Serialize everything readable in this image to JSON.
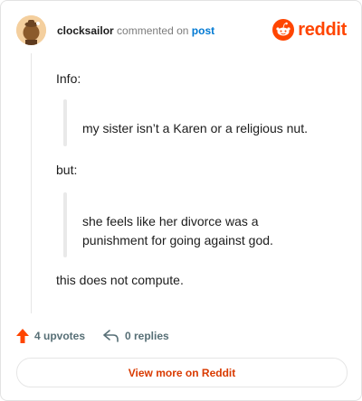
{
  "header": {
    "username": "clocksailor",
    "action_text": "commented on",
    "post_link": "post",
    "brand": "reddit",
    "brand_color": "#ff4500"
  },
  "comment": {
    "paragraph_1": "Info:",
    "quote_1": "my sister isn’t a Karen or a religious nut.",
    "paragraph_2": "but:",
    "quote_2": "she feels like her divorce was a punishment for going against god.",
    "paragraph_3": "this does not compute."
  },
  "actions": {
    "upvotes_label": "4 upvotes",
    "replies_label": "0 replies",
    "upvote_icon": "upvote-arrow-icon",
    "reply_icon": "reply-arrow-icon"
  },
  "footer": {
    "view_more_label": "View more on Reddit"
  }
}
